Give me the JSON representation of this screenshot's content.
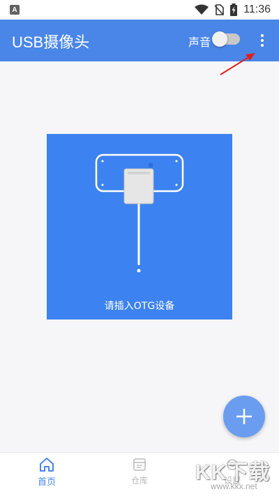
{
  "statusbar": {
    "badge": "A",
    "time": "11:36",
    "icons": [
      "wifi-icon",
      "no-sim-icon",
      "battery-charging-icon"
    ]
  },
  "appbar": {
    "title": "USB摄像头",
    "sound_label": "声音",
    "sound_enabled": false,
    "more_icon": "more-vertical-icon",
    "color": "#4a86e8"
  },
  "main": {
    "otg_prompt": "请插入OTG设备",
    "card_color": "#3c82f0",
    "illustration": "usb-otg-device-icon"
  },
  "fab": {
    "icon": "plus-icon",
    "color": "#6a9df0"
  },
  "bottom_nav": {
    "items": [
      {
        "label": "首页",
        "icon": "home-icon",
        "active": true
      },
      {
        "label": "仓库",
        "icon": "repository-icon",
        "active": false
      },
      {
        "label": "设置",
        "icon": "settings-icon",
        "active": false
      }
    ],
    "active_color": "#4a86e8",
    "inactive_color": "#b8b8b8"
  },
  "watermark": {
    "main": "KK下载",
    "site": "www.kkx.net"
  },
  "annotation": {
    "icon": "red-arrow-icon",
    "color": "#e02020"
  }
}
